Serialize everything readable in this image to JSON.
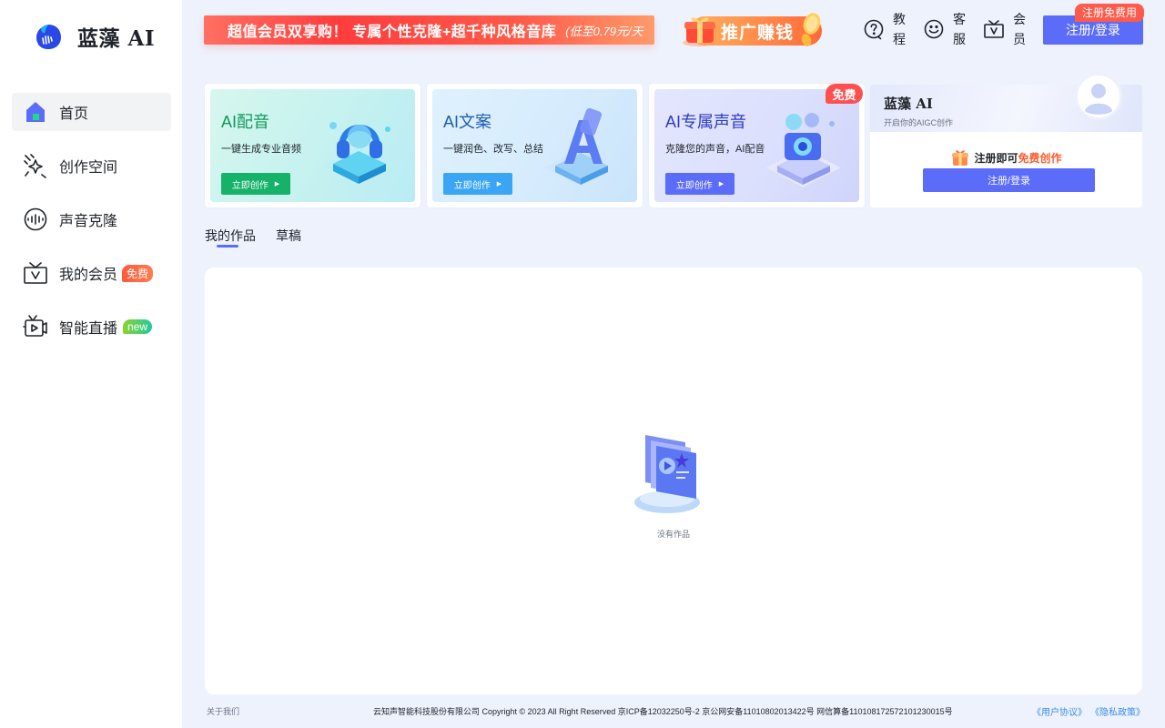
{
  "brand": {
    "name": "蓝藻 AI",
    "accent": "#5b6cf9"
  },
  "sidebar": {
    "items": [
      {
        "label": "首页",
        "icon": "home-icon",
        "active": true
      },
      {
        "label": "创作空间",
        "icon": "sparkle-icon"
      },
      {
        "label": "声音克隆",
        "icon": "voice-wave-icon"
      },
      {
        "label": "我的会员",
        "icon": "vip-icon",
        "badge": "免费"
      },
      {
        "label": "智能直播",
        "icon": "live-icon",
        "badge": "new"
      }
    ]
  },
  "topbar": {
    "promo_main": "超值会员双享购！ 专属个性克隆+超千种风格音库",
    "promo_sub": "(低至0.79元/天",
    "earn_label": "推广赚钱",
    "links": [
      {
        "label": "教程",
        "icon": "question-icon"
      },
      {
        "label": "客服",
        "icon": "smile-icon"
      },
      {
        "label": "会员",
        "icon": "vip-icon"
      }
    ],
    "login_label": "注册/登录",
    "login_tag": "注册免费用"
  },
  "cards": [
    {
      "title": "AI配音",
      "desc": "一键生成专业音频",
      "button": "立即创作",
      "color": "#17b26a",
      "title_color": "#0f9a5a",
      "bg": "linear-gradient(120deg,#d6f7ee,#c4f1f0 60%,#b8ecf5)"
    },
    {
      "title": "AI文案",
      "desc": "一键润色、改写、总结",
      "button": "立即创作",
      "color": "#3aa5f5",
      "title_color": "#1f5fb0",
      "bg": "linear-gradient(120deg,#dff1fd,#d5ebfd 60%,#c9e4fb)"
    },
    {
      "title": "AI专属声音",
      "desc": "克隆您的声音，AI配音",
      "button": "立即创作",
      "color": "#5b6cf9",
      "title_color": "#2d3bc2",
      "bg": "linear-gradient(120deg,#e4e6fd,#dadffd 60%,#cfd4fb)",
      "tag": "免费"
    }
  ],
  "profile": {
    "name": "蓝藻 AI",
    "subtitle": "开启你的AIGC创作",
    "promo_prefix": "注册即可",
    "promo_highlight": "免费创作",
    "button": "注册/登录"
  },
  "tabs": [
    {
      "label": "我的作品",
      "active": true
    },
    {
      "label": "草稿"
    }
  ],
  "empty_state": {
    "text": "没有作品"
  },
  "footer": {
    "about": "关于我们",
    "copyright": "云知声智能科技股份有限公司 Copyright © 2023 All Right Reserved 京ICP备12032250号-2 京公网安备11010802013422号 网信算备110108172572101230015号",
    "user_agreement": "《用户协议》",
    "privacy_policy": "《隐私政策》"
  }
}
